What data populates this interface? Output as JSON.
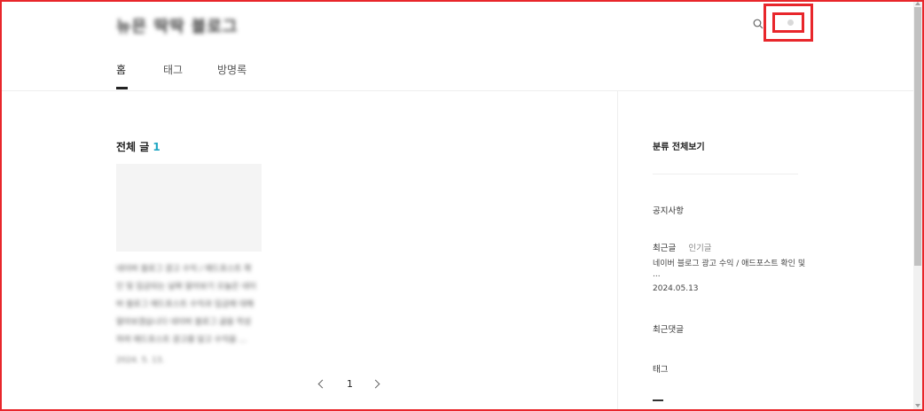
{
  "header": {
    "blog_title": "뉴믄 딱딱 블로그",
    "nav": [
      {
        "label": "홈",
        "active": true
      },
      {
        "label": "태그",
        "active": false
      },
      {
        "label": "방명록",
        "active": false
      }
    ]
  },
  "main": {
    "section_title": "전체 글",
    "section_count": "1",
    "post": {
      "excerpt": "네이버 블로그 광고 수익 / 애드포스트 확인 및 입금되는 날짜 알아보기 오늘은 네이버 블로그 애드포스트 수익과 입금에 대해 알아보겠습니다 네이버 블로그 글을 작성하여 애드포스트 광고를 달고 수익을 ...",
      "date": "2024. 5. 13."
    },
    "pagination": {
      "current": "1"
    }
  },
  "sidebar": {
    "category_all": "분류 전체보기",
    "notice": "공지사항",
    "recent_posts_tab": "최근글",
    "popular_posts_tab": "인기글",
    "recent_post_title_line1": "네이버 블로그 광고 수익 / 애드포스트 확인 및",
    "recent_post_title_line2": "...",
    "recent_post_date": "2024.05.13",
    "recent_comments": "최근댓글",
    "tags": "태그"
  },
  "colors": {
    "accent": "#1fa6c3",
    "highlight": "#e8262b"
  },
  "icons": {
    "search": "search-icon",
    "prev": "chevron-left-icon",
    "next": "chevron-right-icon"
  }
}
